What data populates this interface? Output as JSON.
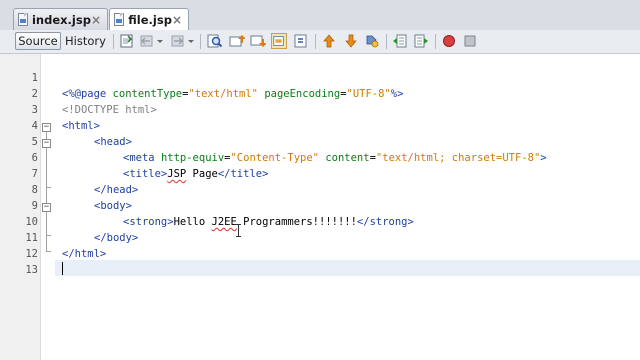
{
  "tabs": [
    {
      "label": "index.jsp",
      "close": "×"
    },
    {
      "label": "file.jsp",
      "close": "×"
    }
  ],
  "toolbar": {
    "source_label": "Source",
    "history_label": "History"
  },
  "editor": {
    "line_numbers": [
      "1",
      "2",
      "3",
      "4",
      "5",
      "6",
      "7",
      "8",
      "9",
      "10",
      "11",
      "12",
      "13"
    ],
    "lines": {
      "l2_a": "<%@page ",
      "l2_attr1": "contentType",
      "l2_eq1": "=",
      "l2_val1": "\"text/html\"",
      "l2_sp": " ",
      "l2_attr2": "pageEncoding",
      "l2_eq2": "=",
      "l2_val2": "\"UTF-8\"",
      "l2_end": "%>",
      "l3": "<!DOCTYPE html>",
      "l4": "<html>",
      "l5": "<head>",
      "l6_open": "<meta ",
      "l6_attr1": "http-equiv",
      "l6_eq1": "=",
      "l6_val1": "\"Content-Type\"",
      "l6_sp": " ",
      "l6_attr2": "content",
      "l6_eq2": "=",
      "l6_val2": "\"text/html; charset=UTF-8\"",
      "l6_close": ">",
      "l7_open": "<title>",
      "l7_text1": "JSP",
      "l7_text2": " Page",
      "l7_close": "</title>",
      "l8": "</head>",
      "l9": "<body>",
      "l10_open": "<strong>",
      "l10_text1": "Hello ",
      "l10_text2": "J2EE",
      "l10_text3": " Programmers!!!!!!!",
      "l10_close": "</strong>",
      "l11": "</body>",
      "l12": "</html>"
    }
  },
  "icons": [
    "file-jsp-icon",
    "back-icon",
    "forward-icon",
    "search-icon",
    "find-previous-icon",
    "find-next-icon",
    "toggle-highlight-icon",
    "find-selection-icon",
    "previous-bookmark-icon",
    "next-bookmark-icon",
    "toggle-bookmark-icon",
    "shift-left-icon",
    "shift-right-icon",
    "start-macro-icon",
    "stop-macro-icon"
  ]
}
